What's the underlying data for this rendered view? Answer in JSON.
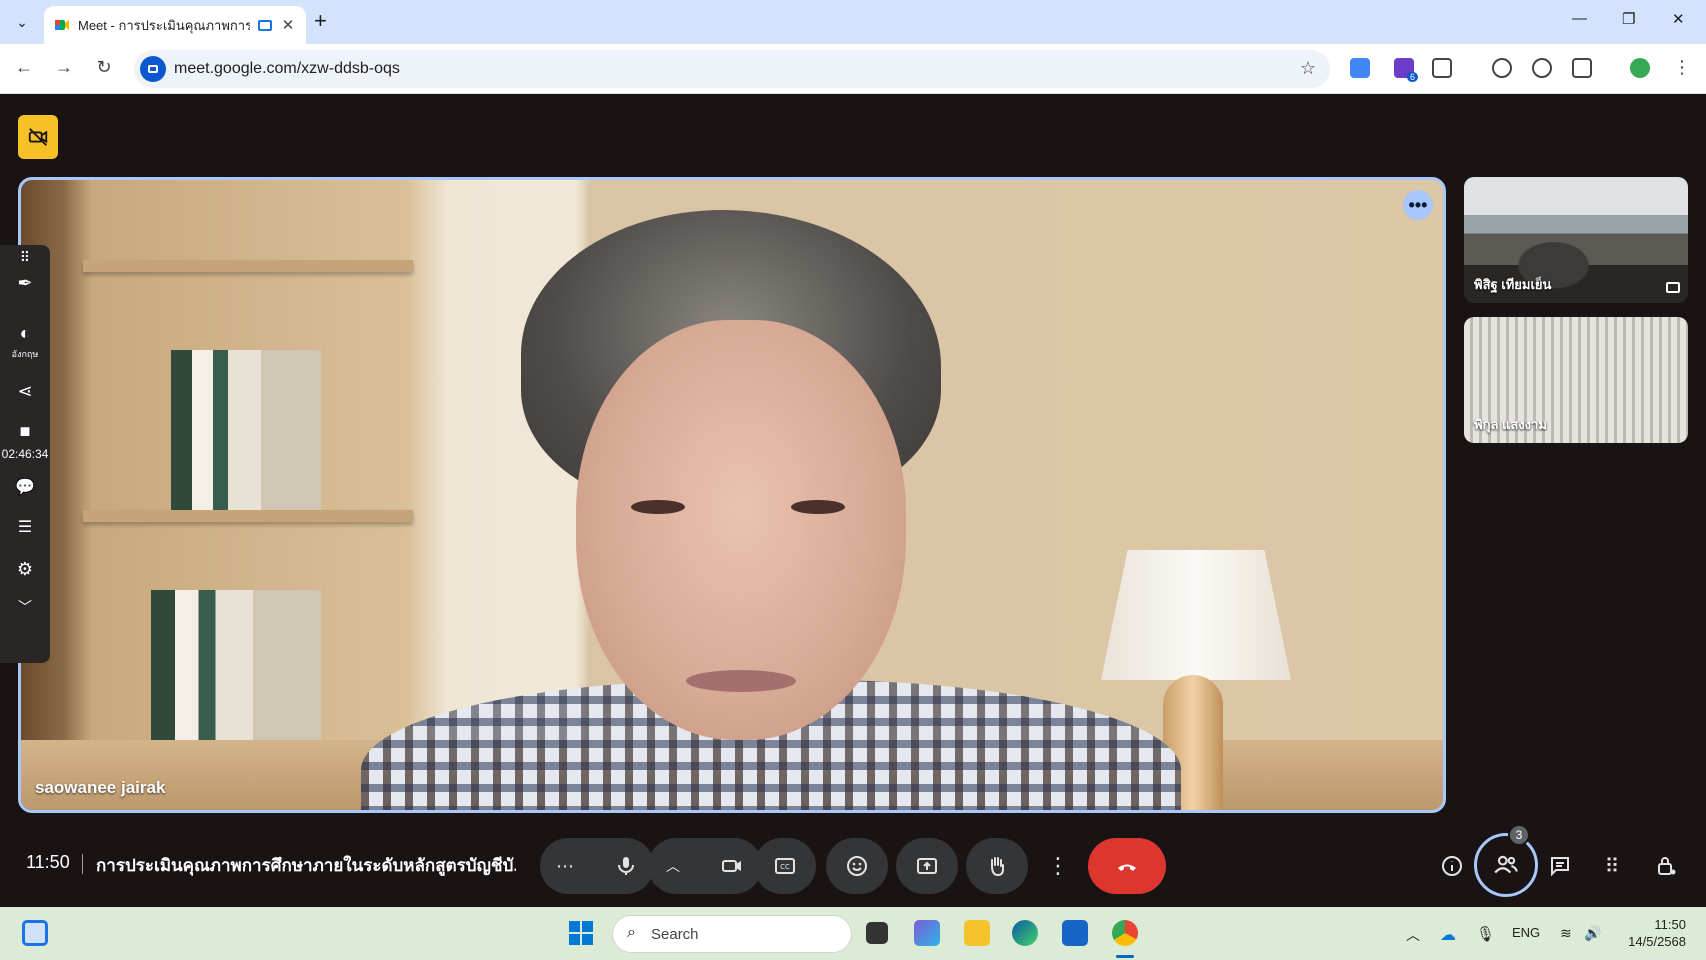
{
  "browser": {
    "tab_title": "Meet - การประเมินคุณภาพการ",
    "url": "meet.google.com/xzw-ddsb-oqs",
    "extension_badge": "6"
  },
  "meet": {
    "main_participant": "saowanee jairak",
    "side_participants": [
      {
        "name": "พิสิฐ เทียมเย็น"
      },
      {
        "name": "พิกุล แสงงาม"
      }
    ],
    "overlay": {
      "toggle_label": "อังกฤษ",
      "timer": "02:46:34"
    },
    "controls": {
      "time": "11:50",
      "meeting_title": "การประเมินคุณภาพการศึกษาภายในระดับหลักสูตรบัญชีบั...",
      "participants_count": "3"
    }
  },
  "taskbar": {
    "search_placeholder": "Search",
    "language": "ENG",
    "time": "11:50",
    "date": "14/5/2568"
  },
  "colors": {
    "meet_bg": "#1a1313",
    "accent": "#a8c7fa",
    "end_call": "#dc362e",
    "cam_off_badge": "#f6c026"
  }
}
